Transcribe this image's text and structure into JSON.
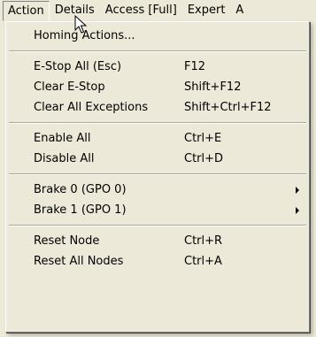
{
  "menubar": {
    "items": [
      {
        "label": "Action"
      },
      {
        "label": "Details"
      },
      {
        "label": "Access [Full]"
      },
      {
        "label": "Expert"
      },
      {
        "label": "A"
      }
    ]
  },
  "action_menu": {
    "groups": [
      [
        {
          "label": "Homing Actions...",
          "shortcut": ""
        }
      ],
      [
        {
          "label": "E-Stop All (Esc)",
          "shortcut": "F12"
        },
        {
          "label": "Clear E-Stop",
          "shortcut": "Shift+F12"
        },
        {
          "label": "Clear All Exceptions",
          "shortcut": "Shift+Ctrl+F12"
        }
      ],
      [
        {
          "label": "Enable All",
          "shortcut": "Ctrl+E"
        },
        {
          "label": "Disable All",
          "shortcut": "Ctrl+D"
        }
      ],
      [
        {
          "label": "Brake 0 (GPO 0)",
          "shortcut": "",
          "submenu": true
        },
        {
          "label": "Brake 1 (GPO 1)",
          "shortcut": "",
          "submenu": true
        }
      ],
      [
        {
          "label": "Reset Node",
          "shortcut": "Ctrl+R"
        },
        {
          "label": "Reset All Nodes",
          "shortcut": "Ctrl+A"
        }
      ]
    ]
  },
  "colors": {
    "menu_background": "#ece9d8",
    "separator_dark": "#aca899"
  },
  "icons": {
    "pointer": "mouse-pointer-icon"
  }
}
